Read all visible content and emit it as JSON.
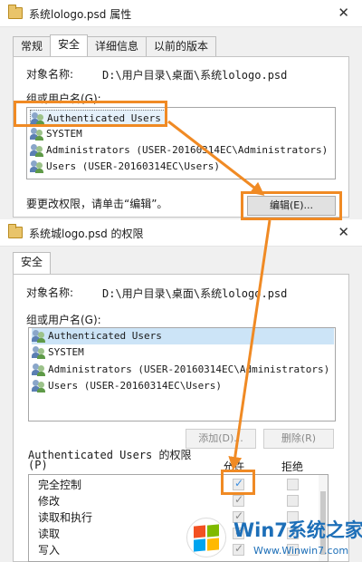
{
  "props_window": {
    "title": "系统lologo.psd 属性",
    "close_glyph": "✕",
    "tabs": [
      "常规",
      "安全",
      "详细信息",
      "以前的版本"
    ],
    "object_label": "对象名称:",
    "object_value": "D:\\用户目录\\桌面\\系统lologo.psd",
    "group_label": "组或用户名(G):",
    "users": [
      "Authenticated Users",
      "SYSTEM",
      "Administrators (USER-20160314EC\\Administrators)",
      "Users (USER-20160314EC\\Users)"
    ],
    "edit_hint": "要更改权限，请单击“编辑”。",
    "edit_button": "编辑(E)..."
  },
  "perm_window": {
    "title": "系统城logo.psd 的权限",
    "close_glyph": "✕",
    "tab": "安全",
    "object_label": "对象名称:",
    "object_value": "D:\\用户目录\\桌面\\系统lologo.psd",
    "group_label": "组或用户名(G):",
    "users": [
      "Authenticated Users",
      "SYSTEM",
      "Administrators (USER-20160314EC\\Administrators)",
      "Users (USER-20160314EC\\Users)"
    ],
    "add_button": "添加(D)...",
    "remove_button": "删除(R)",
    "perm_header_line1": "Authenticated Users 的权限",
    "perm_header_line2": "(P)",
    "allow_header": "允许",
    "deny_header": "拒绝",
    "permissions": [
      {
        "name": "完全控制",
        "allow": true,
        "deny": false
      },
      {
        "name": "修改",
        "allow": true,
        "deny": false
      },
      {
        "name": "读取和执行",
        "allow": true,
        "deny": false
      },
      {
        "name": "读取",
        "allow": true,
        "deny": false
      },
      {
        "name": "写入",
        "allow": true,
        "deny": false
      }
    ]
  },
  "watermark": {
    "brand": "Win7系统之家",
    "url": "Www.Winwin7.com"
  },
  "colors": {
    "highlight": "#f08a24",
    "selection": "#e5f1fb",
    "brand_blue": "#1d6fb8"
  }
}
